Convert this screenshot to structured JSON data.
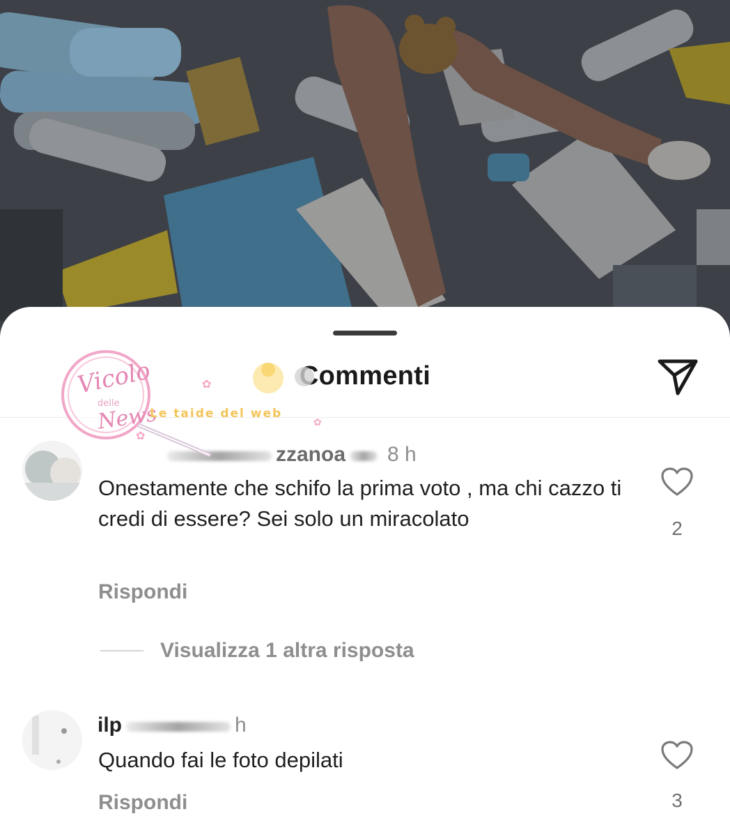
{
  "sheet": {
    "title": "Commenti"
  },
  "icons": {
    "share": "paper-plane-icon",
    "like": "heart-outline-icon"
  },
  "comments": [
    {
      "username_fragment": "zzanoa",
      "time": "8 h",
      "text": "Onestamente che schifo la prima voto , ma chi cazzo ti credi di essere? Sei solo un miracolato",
      "reply_label": "Rispondi",
      "likes": "2",
      "view_replies_label": "Visualizza 1 altra risposta"
    },
    {
      "username_fragment": "ilp",
      "time": "h",
      "text": "Quando fai le foto depilati",
      "reply_label": "Rispondi",
      "likes": "3"
    }
  ],
  "watermark": {
    "logo_text_line1": "Vicolo",
    "logo_text_line2": "delle",
    "logo_text_line3": "News",
    "tagline": "Le taide del web"
  }
}
